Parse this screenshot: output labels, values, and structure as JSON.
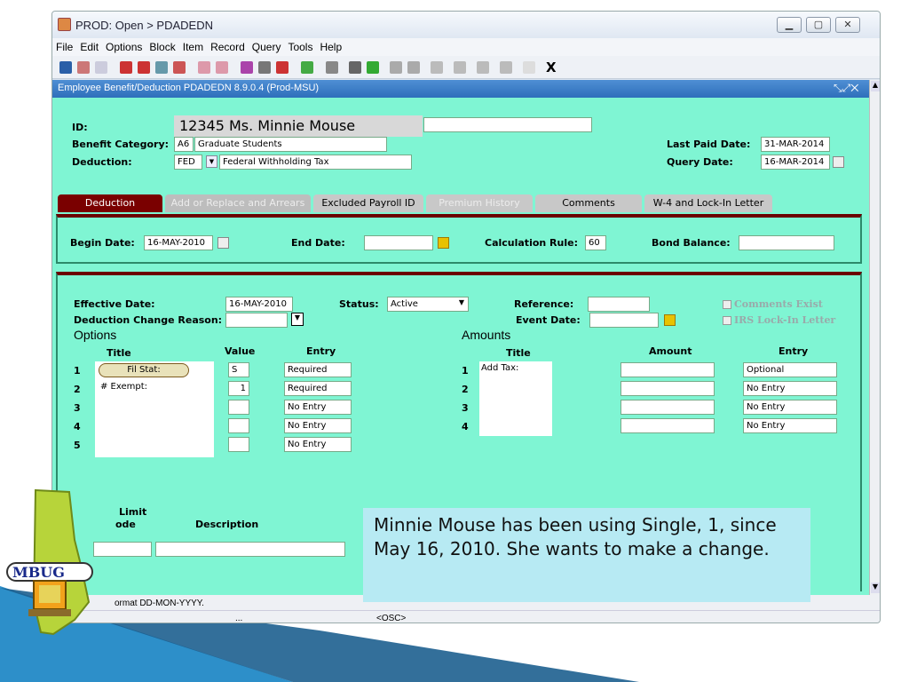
{
  "window": {
    "title": "PROD: Open > PDADEDN"
  },
  "menu": [
    "File",
    "Edit",
    "Options",
    "Block",
    "Item",
    "Record",
    "Query",
    "Tools",
    "Help"
  ],
  "form": {
    "title": "Employee Benefit/Deduction  PDADEDN  8.9.0.4  (Prod-MSU)"
  },
  "key": {
    "id_label": "ID:",
    "id_value": "12345   Ms. Minnie Mouse",
    "benefit_label": "Benefit Category:",
    "benefit_code": "A6",
    "benefit_desc": "Graduate Students",
    "deduction_label": "Deduction:",
    "deduction_code": "FED",
    "deduction_desc": "Federal Withholding Tax",
    "last_paid_label": "Last Paid Date:",
    "last_paid_value": "31-MAR-2014",
    "query_date_label": "Query Date:",
    "query_date_value": "16-MAR-2014"
  },
  "tabs": [
    {
      "label": "Deduction",
      "state": "active"
    },
    {
      "label": "Add or Replace and Arrears",
      "state": "disabled"
    },
    {
      "label": "Excluded Payroll ID",
      "state": "normal"
    },
    {
      "label": "Premium History",
      "state": "disabled"
    },
    {
      "label": "Comments",
      "state": "normal"
    },
    {
      "label": "W-4 and Lock-In Letter",
      "state": "normal"
    }
  ],
  "top_panel": {
    "begin_label": "Begin Date:",
    "begin_value": "16-MAY-2010",
    "end_label": "End Date:",
    "end_value": "",
    "calc_label": "Calculation Rule:",
    "calc_value": "60",
    "bond_label": "Bond Balance:",
    "bond_value": ""
  },
  "detail": {
    "effective_label": "Effective Date:",
    "effective_value": "16-MAY-2010",
    "status_label": "Status:",
    "status_value": "Active",
    "reference_label": "Reference:",
    "reference_value": "",
    "comments_exist": "Comments Exist",
    "change_reason_label": "Deduction Change Reason:",
    "change_reason_value": "",
    "event_date_label": "Event Date:",
    "event_date_value": "",
    "irs_lock": "IRS Lock-In Letter"
  },
  "options": {
    "heading": "Options",
    "col_title": "Title",
    "col_value": "Value",
    "col_entry": "Entry",
    "rows": [
      {
        "n": "1",
        "title": "Fil Stat:",
        "value": "S",
        "entry": "Required"
      },
      {
        "n": "2",
        "title": "# Exempt:",
        "value": "1",
        "entry": "Required"
      },
      {
        "n": "3",
        "title": "",
        "value": "",
        "entry": "No Entry"
      },
      {
        "n": "4",
        "title": "",
        "value": "",
        "entry": "No Entry"
      },
      {
        "n": "5",
        "title": "",
        "value": "",
        "entry": "No Entry"
      }
    ]
  },
  "amounts": {
    "heading": "Amounts",
    "col_title": "Title",
    "col_amount": "Amount",
    "col_entry": "Entry",
    "title_text": "Add Tax:",
    "rows": [
      {
        "n": "1",
        "amount": "",
        "entry": "Optional"
      },
      {
        "n": "2",
        "amount": "",
        "entry": "No Entry"
      },
      {
        "n": "3",
        "amount": "",
        "entry": "No Entry"
      },
      {
        "n": "4",
        "amount": "",
        "entry": "No Entry"
      }
    ]
  },
  "limit": {
    "limit_label": "Limit",
    "code_label": "ode",
    "desc_label": "Description"
  },
  "status": {
    "hint": "ormat DD-MON-YYYY.",
    "dots": "...",
    "osc": "<OSC>"
  },
  "callout": {
    "text": "Minnie Mouse has been using Single, 1, since May 16, 2010.  She wants to make a change."
  },
  "logo": {
    "text": "MBUG"
  }
}
